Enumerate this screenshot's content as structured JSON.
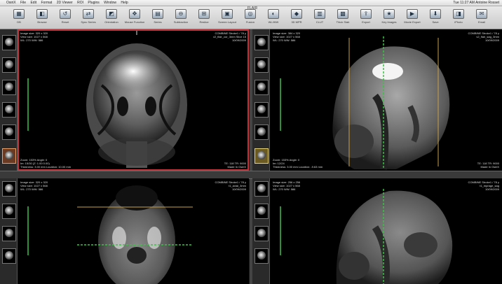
{
  "menubar": {
    "apple": "",
    "items": [
      "OsiriX",
      "File",
      "Edit",
      "Format",
      "2D Viewer",
      "ROI",
      "Plugins",
      "Window",
      "Help"
    ],
    "right": "Tue 11:27 AM    Antoine Rosset"
  },
  "window": {
    "title": "FLAIR"
  },
  "toolbar": {
    "buttons": [
      {
        "label": "DB",
        "icon": "▦"
      },
      {
        "label": "Browse",
        "icon": "◧"
      },
      {
        "label": "Reset",
        "icon": "↺"
      },
      {
        "label": "Sync Series",
        "icon": "⇄"
      },
      {
        "label": "Orientation",
        "icon": "◩"
      },
      {
        "label": "Mouse Function",
        "icon": "✥"
      },
      {
        "label": "Series",
        "icon": "▤"
      },
      {
        "label": "Subtraction",
        "icon": "⊖"
      },
      {
        "label": "Reslice",
        "icon": "⊞"
      },
      {
        "label": "Screen Layout",
        "icon": "▣"
      },
      {
        "label": "Fusion",
        "icon": "◎"
      },
      {
        "label": "WL/WW",
        "icon": "◐"
      },
      {
        "label": "3D MPR",
        "icon": "◆"
      },
      {
        "label": "CLUT",
        "icon": "▥"
      },
      {
        "label": "Thick Slab",
        "icon": "▩"
      },
      {
        "label": "Export",
        "icon": "⇪"
      },
      {
        "label": "Key Images",
        "icon": "★"
      },
      {
        "label": "Movie Export",
        "icon": "▶"
      },
      {
        "label": "Save",
        "icon": "⬇"
      },
      {
        "label": "iPhoto",
        "icon": "◨"
      },
      {
        "label": "Email",
        "icon": "✉"
      }
    ]
  },
  "viewers": {
    "top_left": {
      "tl": [
        "Image size: 320 x 320",
        "View size: 1027 x 568",
        "WL: 270 WW: 586"
      ],
      "tr": [
        "COMBINE Stroke1 / 78 y",
        "v2_flair_cor_3mm Slice 15",
        "10/09/2009"
      ],
      "bl": [
        "Zoom: 153%  Angle: 0",
        "Im: 15/30  (Z: 1.00  0.00)",
        "Thickness: 3.00 mm  Location: 10.00 mm"
      ],
      "br": [
        "TE: 118 TR: 9000",
        "Made In OsiriX"
      ]
    },
    "top_right": {
      "tl": [
        "Image size: 384 x 320",
        "View size: 1027 x 568",
        "WL: 270 WW: 586"
      ],
      "tr": [
        "COMBINE Stroke1 / 78 y",
        "v2_flair_sag_3mm",
        "10/09/2009"
      ],
      "bl": [
        "Zoom: 153%  Angle: 0",
        "Im: 12/24",
        "Thickness: 3.00 mm  Location: -9.63 mm"
      ],
      "br": [
        "TE: 118 TR: 9000",
        "Made In OsiriX"
      ]
    },
    "bottom_left": {
      "tl": [
        "Image size: 320 x 320",
        "View size: 1027 x 568",
        "WL: 270 WW: 586"
      ],
      "tr": [
        "COMBINE Stroke1 / 78 y",
        "t1_axial_3mm",
        "10/09/2009"
      ],
      "bl": [],
      "br": []
    },
    "bottom_right": {
      "tl": [
        "Image size: 256 x 256",
        "View size: 1027 x 568",
        "WL: 270 WW: 586"
      ],
      "tr": [
        "COMBINE Stroke1 / 78 y",
        "t1_mprage_sag",
        "10/09/2009"
      ],
      "bl": [],
      "br": []
    }
  },
  "colors": {
    "active_border": "#c3323a",
    "crosshair": "#3fbf4a",
    "ref_line": "#c9a24a"
  }
}
